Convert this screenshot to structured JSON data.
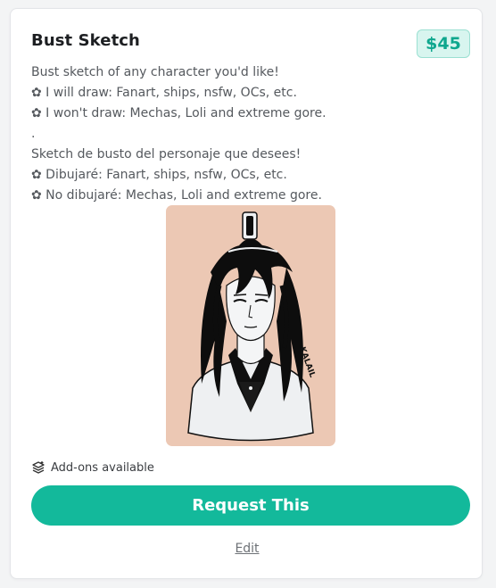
{
  "listing": {
    "title": "Bust Sketch",
    "price": "$45",
    "description_lines": [
      "Bust sketch of any character you'd like!",
      "✿ I will draw: Fanart, ships, nsfw, OCs, etc.",
      "✿ I won't draw: Mechas, Loli and extreme gore.",
      ".",
      "Sketch de busto del personaje que desees!",
      "✿ Dibujaré: Fanart, ships, nsfw, OCs, etc.",
      "✿ No dibujaré: Mechas, Loli and extreme gore."
    ],
    "artwork": {
      "signature": "KALAIL",
      "icon": "bust-sketch-artwork"
    },
    "addons_label": "Add-ons available",
    "addons_icon": "layers-icon",
    "request_label": "Request This",
    "edit_label": "Edit"
  },
  "colors": {
    "accent": "#13b99b",
    "price_text": "#0ea78e",
    "price_bg": "#d8f5ef",
    "artwork_bg": "#ecc8b4"
  }
}
